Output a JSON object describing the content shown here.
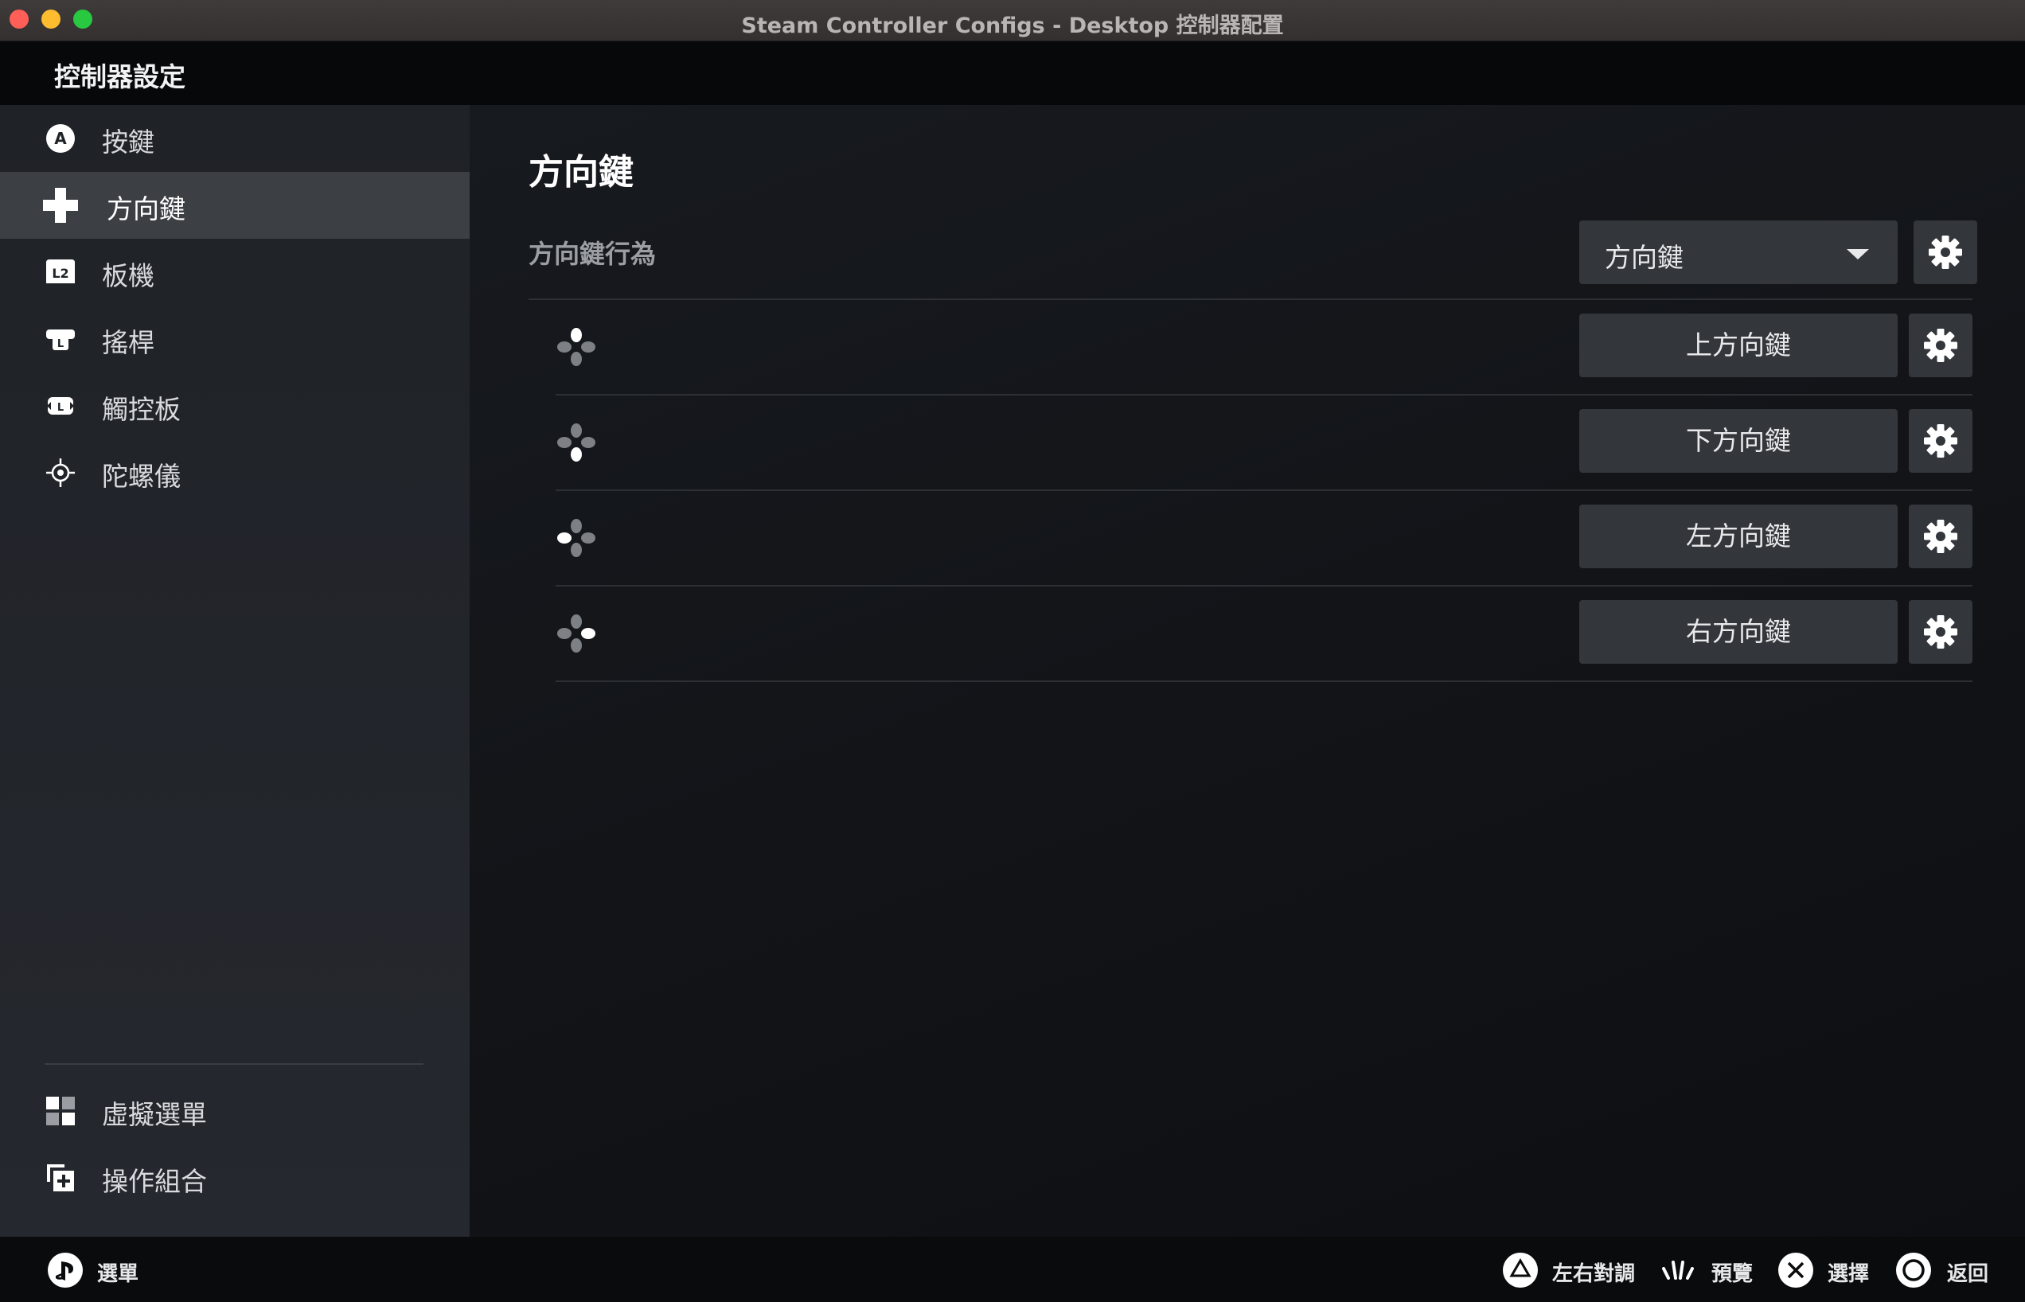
{
  "window": {
    "title": "Steam Controller Configs - Desktop 控制器配置"
  },
  "header": {
    "title": "控制器設定"
  },
  "sidebar": {
    "items": [
      {
        "label": "按鍵",
        "icon": "a-button-icon"
      },
      {
        "label": "方向鍵",
        "icon": "dpad-icon",
        "active": true
      },
      {
        "label": "板機",
        "icon": "l2-trigger-icon"
      },
      {
        "label": "搖桿",
        "icon": "joystick-icon"
      },
      {
        "label": "觸控板",
        "icon": "trackpad-icon"
      },
      {
        "label": "陀螺儀",
        "icon": "gyro-icon"
      }
    ],
    "bottom_items": [
      {
        "label": "虛擬選單",
        "icon": "grid-icon"
      },
      {
        "label": "操作組合",
        "icon": "action-set-icon"
      }
    ]
  },
  "main": {
    "title": "方向鍵",
    "behavior": {
      "label": "方向鍵行為",
      "value": "方向鍵"
    },
    "rows": [
      {
        "direction": "up",
        "binding": "上方向鍵"
      },
      {
        "direction": "down",
        "binding": "下方向鍵"
      },
      {
        "direction": "left",
        "binding": "左方向鍵"
      },
      {
        "direction": "right",
        "binding": "右方向鍵"
      }
    ]
  },
  "footer": {
    "left": {
      "label": "選單",
      "icon": "playstation-icon"
    },
    "right": [
      {
        "label": "左右對調",
        "icon": "triangle-button-icon"
      },
      {
        "label": "預覽",
        "icon": "preview-icon"
      },
      {
        "label": "選擇",
        "icon": "cross-button-icon"
      },
      {
        "label": "返回",
        "icon": "circle-button-icon"
      }
    ]
  },
  "colors": {
    "accent": "#ffffff",
    "panel": "#33363b",
    "sidebar_active": "#3c3f44"
  }
}
